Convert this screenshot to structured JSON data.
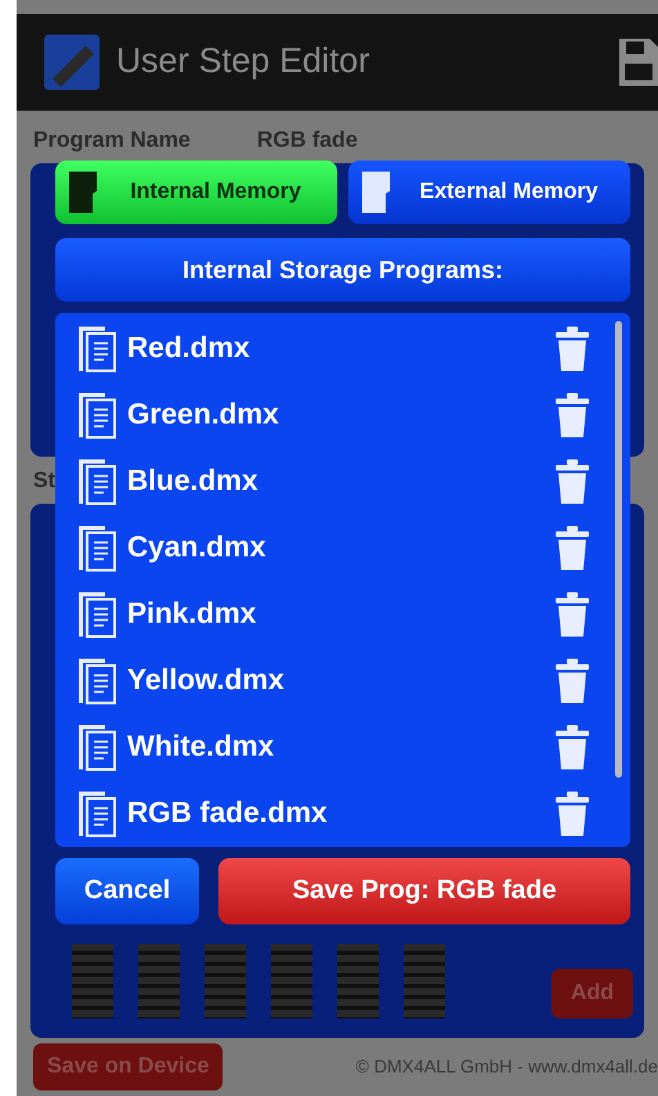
{
  "app_bar": {
    "title": "User Step Editor"
  },
  "background": {
    "program_name_label": "Program Name",
    "program_name_value": "RGB fade",
    "steps_label": "St",
    "add_button": "Add",
    "save_on_device_button": "Save on Device",
    "footer": "© DMX4ALL GmbH - www.dmx4all.de"
  },
  "dialog": {
    "storage_tabs": [
      {
        "label": "Internal Memory",
        "selected": true
      },
      {
        "label": "External Memory",
        "selected": false
      }
    ],
    "header": "Internal Storage Programs:",
    "files": [
      {
        "name": "Red.dmx"
      },
      {
        "name": "Green.dmx"
      },
      {
        "name": "Blue.dmx"
      },
      {
        "name": "Cyan.dmx"
      },
      {
        "name": "Pink.dmx"
      },
      {
        "name": "Yellow.dmx"
      },
      {
        "name": "White.dmx"
      },
      {
        "name": "RGB fade.dmx"
      }
    ],
    "buttons": [
      {
        "label": "Cancel",
        "kind": "cancel"
      },
      {
        "label": "Save Prog: RGB fade",
        "kind": "save"
      }
    ]
  }
}
